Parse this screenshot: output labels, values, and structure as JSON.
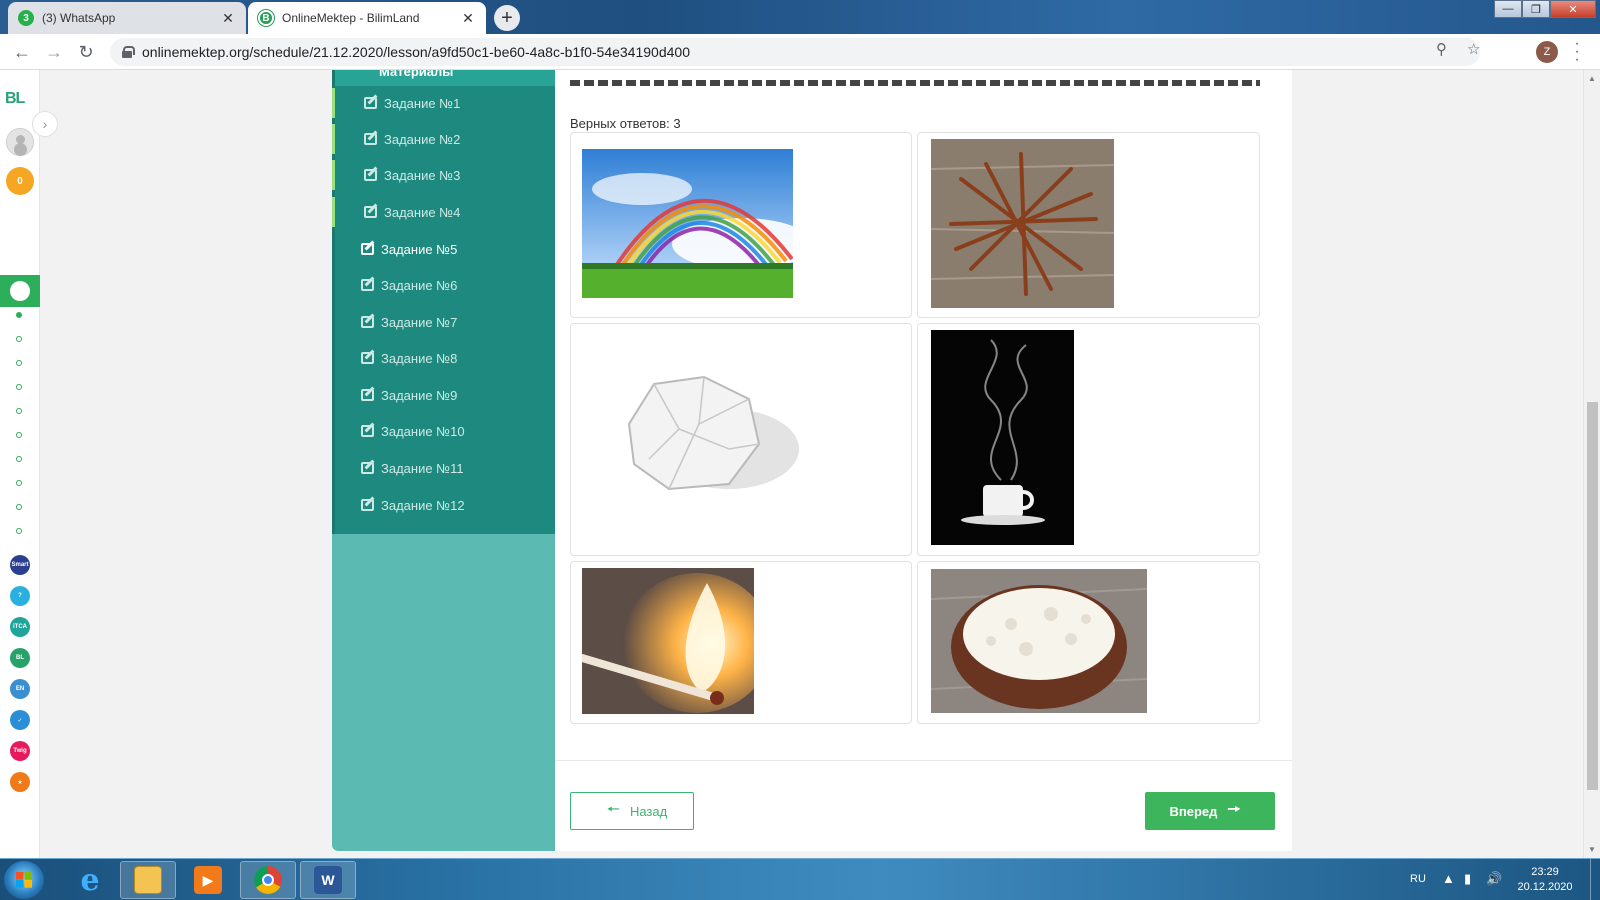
{
  "browser": {
    "tabs": [
      {
        "title": "(3) WhatsApp",
        "badge": "3",
        "icon": "whatsapp-icon"
      },
      {
        "title": "OnlineMektep - BilimLand",
        "badge": "B",
        "icon": "bilimland-icon"
      }
    ],
    "new_tab": "+",
    "close": "✕",
    "url": "onlinemektep.org/schedule/21.12.2020/lesson/a9fd50c1-be60-4a8c-b1f0-54e34190d400",
    "profile_initial": "Z",
    "window_controls": {
      "minimize": "—",
      "maximize": "❐",
      "close": "✕"
    }
  },
  "rail": {
    "logo": "BL",
    "coins": "0",
    "apps": [
      {
        "label": "Smart",
        "color": "#2a3f8f"
      },
      {
        "label": "?",
        "color": "#2ab0e0"
      },
      {
        "label": "iTCA",
        "color": "#1fa59a"
      },
      {
        "label": "BL",
        "color": "#27a36a"
      },
      {
        "label": "EN",
        "color": "#3a8fd0"
      },
      {
        "label": "✓",
        "color": "#2b8fd8"
      },
      {
        "label": "Twig",
        "color": "#e6195a"
      },
      {
        "label": "★",
        "color": "#f07a1a"
      }
    ]
  },
  "sidebar": {
    "header": "Материалы",
    "tasks": [
      {
        "label": "Задание №1",
        "state": "done"
      },
      {
        "label": "Задание №2",
        "state": "done"
      },
      {
        "label": "Задание №3",
        "state": "done"
      },
      {
        "label": "Задание №4",
        "state": "done"
      },
      {
        "label": "Задание №5",
        "state": "current"
      },
      {
        "label": "Задание №6",
        "state": "todo"
      },
      {
        "label": "Задание №7",
        "state": "todo"
      },
      {
        "label": "Задание №8",
        "state": "todo"
      },
      {
        "label": "Задание №9",
        "state": "todo"
      },
      {
        "label": "Задание №10",
        "state": "todo"
      },
      {
        "label": "Задание №11",
        "state": "todo"
      },
      {
        "label": "Задание №12",
        "state": "todo"
      }
    ]
  },
  "quiz": {
    "correct_answers": "Верных ответов: 3",
    "images": [
      "rainbow",
      "rusty-nails",
      "crumpled-paper",
      "steaming-cup",
      "burning-match",
      "cottage-cheese"
    ]
  },
  "nav": {
    "back": "Назад",
    "forward": "Вперед"
  },
  "taskbar": {
    "lang": "RU",
    "time": "23:29",
    "date": "20.12.2020"
  },
  "colors": {
    "accent_green": "#3cb55c",
    "sidebar_dark": "#1e8a7f",
    "sidebar_light": "#5bbbb3"
  }
}
